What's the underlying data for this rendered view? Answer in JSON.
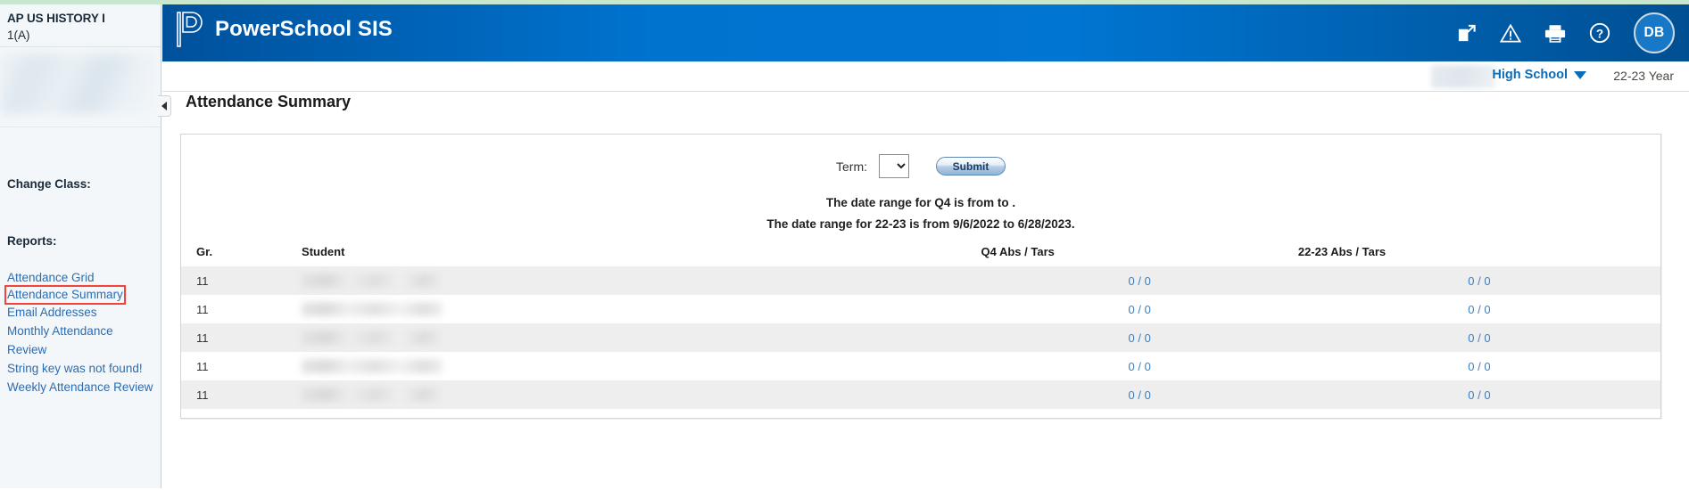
{
  "sidebar": {
    "class_name": "AP US HISTORY I",
    "class_section": "1(A)",
    "change_class_heading": "Change Class:",
    "reports_heading": "Reports:",
    "report_links": [
      {
        "label": "Attendance Grid",
        "selected": false
      },
      {
        "label": "Attendance Summary",
        "selected": true
      },
      {
        "label": "Email Addresses",
        "selected": false
      },
      {
        "label": "Monthly Attendance Review",
        "selected": false
      },
      {
        "label": "String key was not found!",
        "selected": false
      },
      {
        "label": "Weekly Attendance Review",
        "selected": false
      }
    ]
  },
  "header": {
    "brand": "PowerSchool SIS",
    "logo_icon": "powerschool-p-logo",
    "icons": [
      {
        "name": "external-link-icon",
        "title": "Open in new window"
      },
      {
        "name": "warning-triangle-icon",
        "title": "Alerts"
      },
      {
        "name": "printer-icon",
        "title": "Print"
      },
      {
        "name": "help-question-icon",
        "title": "Help"
      }
    ],
    "avatar_initials": "DB"
  },
  "sub_header": {
    "school": "High School",
    "school_chevron_icon": "chevron-down-icon",
    "year": "22-23 Year"
  },
  "page": {
    "title": "Attendance Summary",
    "collapse_icon": "collapse-left-arrow-icon"
  },
  "form": {
    "term_label": "Term:",
    "term_value": "",
    "term_options": [
      ""
    ],
    "submit_label": "Submit"
  },
  "info": {
    "line1": "The date range for Q4 is from to .",
    "line2": "The date range for 22-23 is from 9/6/2022 to 6/28/2023."
  },
  "table": {
    "columns": {
      "grade": "Gr.",
      "student": "Student",
      "q4": "Q4 Abs / Tars",
      "year": "22-23 Abs / Tars"
    },
    "rows": [
      {
        "grade": "11",
        "student": "",
        "q4": "0 / 0",
        "year": "0 / 0"
      },
      {
        "grade": "11",
        "student": "",
        "q4": "0 / 0",
        "year": "0 / 0"
      },
      {
        "grade": "11",
        "student": "",
        "q4": "0 / 0",
        "year": "0 / 0"
      },
      {
        "grade": "11",
        "student": "",
        "q4": "0 / 0",
        "year": "0 / 0"
      },
      {
        "grade": "11",
        "student": "",
        "q4": "0 / 0",
        "year": "0 / 0"
      }
    ]
  },
  "colors": {
    "header_blue": "#0073cf",
    "link_blue": "#2b6cb3",
    "highlight_red": "#f0453a",
    "top_strip_green": "#c7e7cf"
  }
}
